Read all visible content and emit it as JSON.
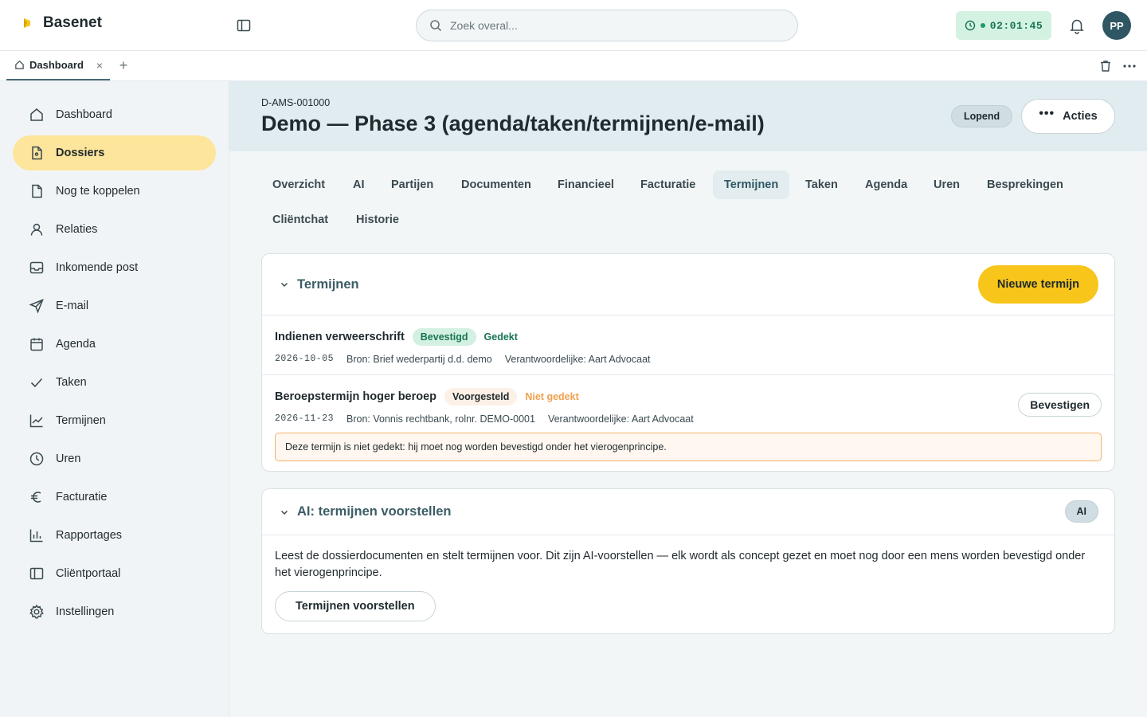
{
  "app": {
    "name": "Basenet",
    "logo_icon": "basenet-logo",
    "accent": "#f8c51a"
  },
  "search": {
    "placeholder": "Zoek overal..."
  },
  "timer": {
    "value": "02:01:45",
    "color": "#187553"
  },
  "user": {
    "initials": "PP"
  },
  "tabs": [
    {
      "label": "Dashboard",
      "close": "×"
    }
  ],
  "tab_add": "+",
  "sidebar": {
    "items": [
      {
        "label": "Dashboard",
        "icon": "home-icon"
      },
      {
        "label": "Dossiers",
        "icon": "file-icon",
        "active": true
      },
      {
        "label": "Nog te koppelen",
        "icon": "file-icon"
      },
      {
        "label": "Relaties",
        "icon": "user-icon"
      },
      {
        "label": "Inkomende post",
        "icon": "inbox-icon"
      },
      {
        "label": "E-mail",
        "icon": "send-icon"
      },
      {
        "label": "Agenda",
        "icon": "calendar-icon"
      },
      {
        "label": "Taken",
        "icon": "check-icon"
      },
      {
        "label": "Termijnen",
        "icon": "chart-line-icon"
      },
      {
        "label": "Uren",
        "icon": "clock-icon"
      },
      {
        "label": "Facturatie",
        "icon": "euro-icon"
      },
      {
        "label": "Rapportages",
        "icon": "bar-chart-icon"
      },
      {
        "label": "Cliëntportaal",
        "icon": "panel-icon"
      },
      {
        "label": "Instellingen",
        "icon": "gear-icon"
      }
    ]
  },
  "case": {
    "id": "D-AMS-001000",
    "title": "Demo — Phase 3 (agenda/taken/termijnen/e-mail)",
    "status": "Lopend",
    "actions_label": "Acties",
    "actions_dots": "•••"
  },
  "section_tabs": [
    {
      "label": "Overzicht"
    },
    {
      "label": "AI"
    },
    {
      "label": "Partijen"
    },
    {
      "label": "Documenten"
    },
    {
      "label": "Financieel"
    },
    {
      "label": "Facturatie"
    },
    {
      "label": "Termijnen",
      "active": true
    },
    {
      "label": "Taken"
    },
    {
      "label": "Agenda"
    },
    {
      "label": "Uren"
    },
    {
      "label": "Besprekingen"
    },
    {
      "label": "Cliëntchat"
    },
    {
      "label": "Historie"
    }
  ],
  "termijnen": {
    "title": "Termijnen",
    "new_button": "Nieuwe termijn",
    "rows": [
      {
        "title": "Indienen verweerschrift",
        "badge": "Bevestigd",
        "coverage": "Gedekt",
        "date": "2026-10-05",
        "source": "Bron: Brief wederpartij d.d. demo",
        "responsible": "Verantwoordelijke: Aart Advocaat"
      },
      {
        "title": "Beroepstermijn hoger beroep",
        "badge": "Voorgesteld",
        "coverage": "Niet gedekt",
        "date": "2026-11-23",
        "source": "Bron: Vonnis rechtbank, rolnr. DEMO-0001",
        "responsible": "Verantwoordelijke: Aart Advocaat",
        "confirm_button": "Bevestigen",
        "warning": "Deze termijn is niet gedekt: hij moet nog worden bevestigd onder het vierogenprincipe."
      }
    ]
  },
  "ai_panel": {
    "title": "AI: termijnen voorstellen",
    "badge": "AI",
    "description": "Leest de dossierdocumenten en stelt termijnen voor. Dit zijn AI-voorstellen — elk wordt als concept gezet en moet nog door een mens worden bevestigd onder het vierogenprincipe.",
    "button": "Termijnen voorstellen"
  }
}
